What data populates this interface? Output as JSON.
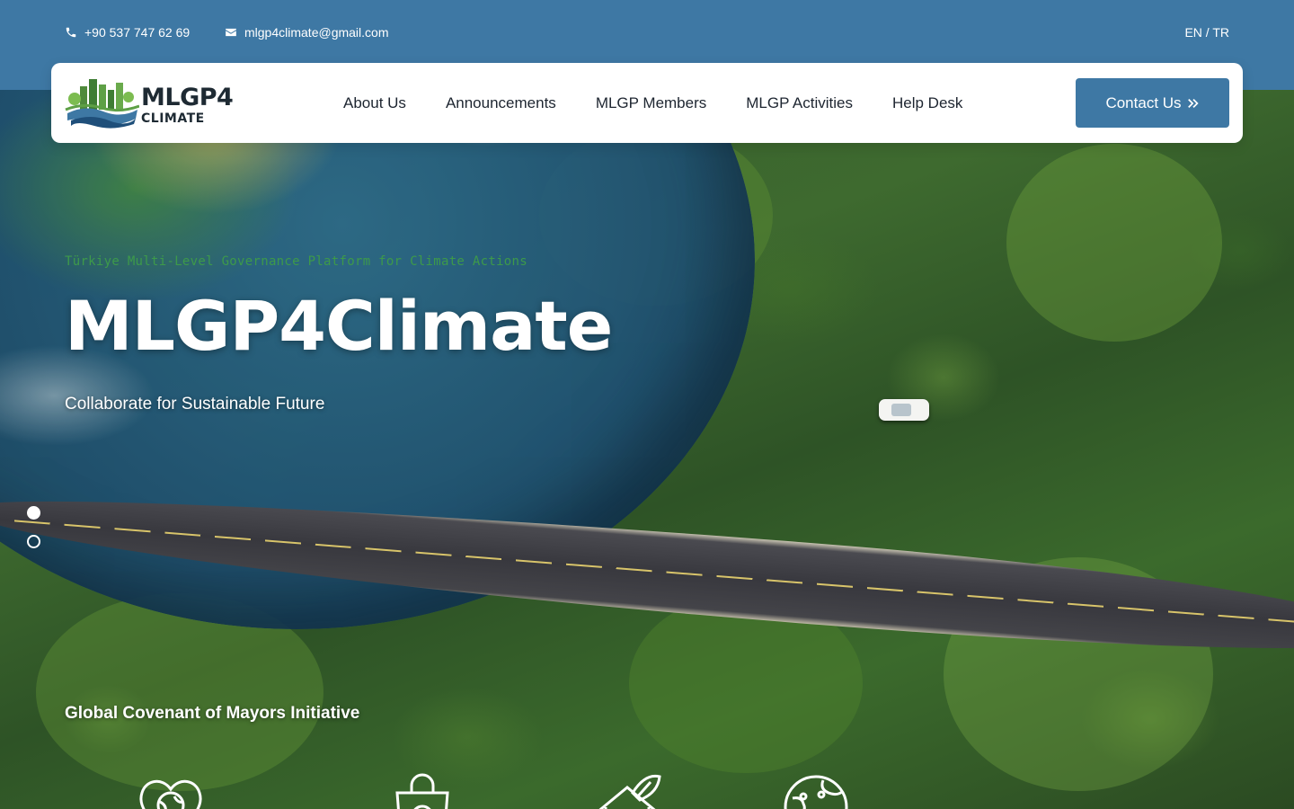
{
  "topbar": {
    "phone": "+90 537 747 62 69",
    "email": "mlgp4climate@gmail.com",
    "language": "EN / TR",
    "icons": [
      "phone-icon",
      "envelope-icon"
    ]
  },
  "brand": {
    "logo_title": "MLGP4",
    "logo_subtitle": "CLIMATE"
  },
  "nav": {
    "items": [
      {
        "label": "About Us"
      },
      {
        "label": "Announcements"
      },
      {
        "label": "MLGP Members"
      },
      {
        "label": "MLGP Activities"
      },
      {
        "label": "Help Desk"
      }
    ],
    "cta_label": "Contact Us",
    "cta_icon": "double-chevron-right-icon"
  },
  "hero": {
    "eyebrow": "Türkiye Multi-Level Governance Platform for Climate Actions",
    "title": "MLGP4Climate",
    "tagline": "Collaborate for Sustainable Future",
    "slides": {
      "count": 2,
      "active": 1
    }
  },
  "initiative": {
    "title": "Global Covenant of Mayors Initiative",
    "icons": [
      "heart-globe-icon",
      "shopping-bag-icon",
      "house-leaf-icon",
      "globe-icon"
    ]
  },
  "colors": {
    "brand_blue": "#3e78a4",
    "accent_green": "#3d9a4a",
    "nav_bg": "#ffffff"
  }
}
